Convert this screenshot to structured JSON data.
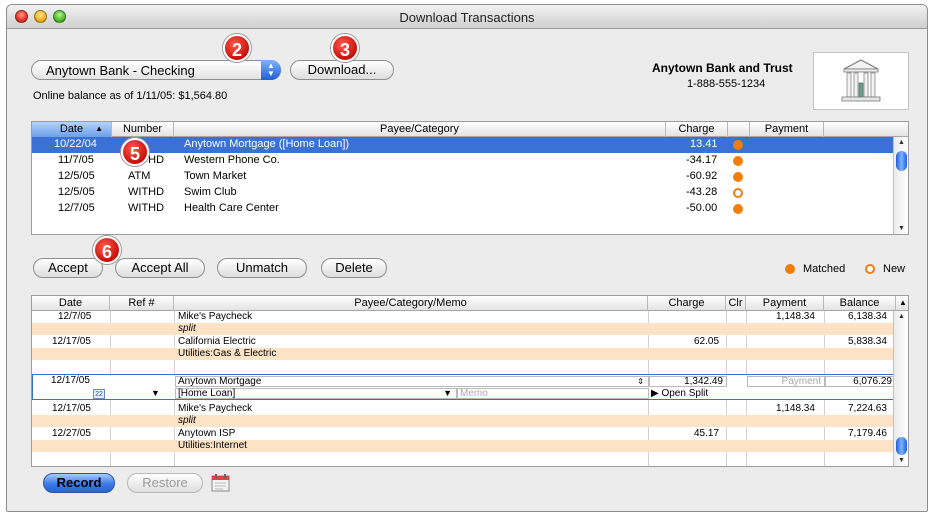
{
  "window": {
    "title": "Download Transactions"
  },
  "account": {
    "selected": "Anytown Bank - Checking",
    "online_balance": "Online balance as of 1/11/05: $1,564.80"
  },
  "buttons": {
    "download": "Download...",
    "accept": "Accept",
    "accept_all": "Accept All",
    "unmatch": "Unmatch",
    "delete": "Delete",
    "record": "Record",
    "restore": "Restore"
  },
  "bank": {
    "name": "Anytown Bank and Trust",
    "phone": "1-888-555-1234"
  },
  "callouts": {
    "c2": "2",
    "c3": "3",
    "c5": "5",
    "c6": "6"
  },
  "download_table": {
    "headers": {
      "date": "Date",
      "number": "Number",
      "payee": "Payee/Category",
      "charge": "Charge",
      "payment": "Payment"
    },
    "sort_arrow": "▲",
    "rows": [
      {
        "date": "10/22/04",
        "number": "",
        "payee": "Anytown Mortgage ([Home Loan])",
        "charge": "13.41",
        "status": "matched"
      },
      {
        "date": "11/7/05",
        "number": "WITHD",
        "payee": "Western Phone Co.",
        "charge": "-34.17",
        "status": "matched"
      },
      {
        "date": "12/5/05",
        "number": "ATM",
        "payee": "Town Market",
        "charge": "-60.92",
        "status": "matched"
      },
      {
        "date": "12/5/05",
        "number": "WITHD",
        "payee": "Swim Club",
        "charge": "-43.28",
        "status": "new"
      },
      {
        "date": "12/7/05",
        "number": "WITHD",
        "payee": "Health Care Center",
        "charge": "-50.00",
        "status": "matched"
      }
    ]
  },
  "legend": {
    "matched": "Matched",
    "new": "New"
  },
  "register": {
    "headers": {
      "date": "Date",
      "ref": "Ref #",
      "payee": "Payee/Category/Memo",
      "charge": "Charge",
      "clr": "Clr",
      "payment": "Payment",
      "balance": "Balance"
    },
    "rows": [
      {
        "date": "12/7/05",
        "payee": "Mike's Paycheck",
        "category": "split",
        "charge": "",
        "payment": "1,148.34",
        "balance": "6,138.34"
      },
      {
        "date": "12/17/05",
        "payee": "California Electric",
        "category": "Utilities:Gas & Electric",
        "charge": "62.05",
        "payment": "",
        "balance": "5,838.34"
      },
      {
        "date": "12/17/05",
        "payee": "Anytown Mortgage",
        "category": "[Home Loan]",
        "charge": "1,342.49",
        "payment": "",
        "balance": "6,076.29",
        "editing": true
      },
      {
        "date": "12/17/05",
        "payee": "Mike's Paycheck",
        "category": "split",
        "charge": "",
        "payment": "1,148.34",
        "balance": "7,224.63"
      },
      {
        "date": "12/27/05",
        "payee": "Anytown ISP",
        "category": "Utilities:Internet",
        "charge": "45.17",
        "payment": "",
        "balance": "7,179.46"
      }
    ],
    "edit": {
      "memo_placeholder": "Memo",
      "payment_placeholder": "Payment",
      "open_split": "▶ Open Split",
      "cal_day": "22"
    }
  },
  "colors": {
    "matched": "#f07d0a",
    "selection": "#3b70d4",
    "split_row": "#fce3c6"
  }
}
